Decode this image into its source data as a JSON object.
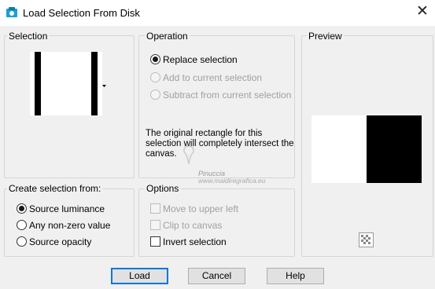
{
  "window": {
    "title": "Load Selection From Disk",
    "close_glyph": "✕"
  },
  "selection": {
    "label": "Selection"
  },
  "operation": {
    "label": "Operation",
    "options": [
      {
        "label": "Replace selection",
        "selected": true,
        "enabled": true
      },
      {
        "label": "Add to current selection",
        "selected": false,
        "enabled": false
      },
      {
        "label": "Subtract from current selection",
        "selected": false,
        "enabled": false
      }
    ],
    "message": "The original rectangle for this selection will completely intersect the canvas."
  },
  "preview": {
    "label": "Preview"
  },
  "create_from": {
    "label": "Create selection from:",
    "options": [
      {
        "label": "Source luminance",
        "selected": true
      },
      {
        "label": "Any non-zero value",
        "selected": false
      },
      {
        "label": "Source opacity",
        "selected": false
      }
    ]
  },
  "options": {
    "label": "Options",
    "items": [
      {
        "label": "Move to upper left",
        "checked": false,
        "enabled": false
      },
      {
        "label": "Clip to canvas",
        "checked": false,
        "enabled": false
      },
      {
        "label": "Invert selection",
        "checked": false,
        "enabled": true
      }
    ]
  },
  "watermark": {
    "line1": "Pinuccia",
    "line2": "www.maidiregrafica.eu"
  },
  "buttons": {
    "load": "Load",
    "cancel": "Cancel",
    "help": "Help"
  },
  "colors": {
    "accent": "#0078d7",
    "title_icon": "#1a9fd4"
  }
}
